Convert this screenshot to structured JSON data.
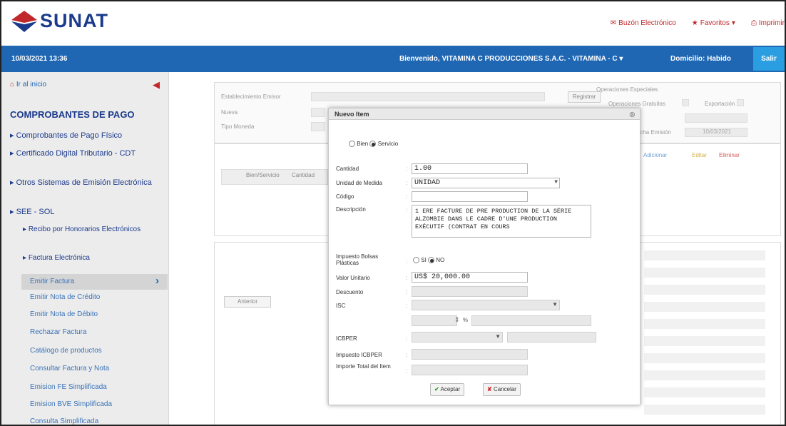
{
  "header": {
    "logo_text": "SUNAT",
    "links": [
      {
        "label": "Buzón Electrónico",
        "icon": "mailbox-icon"
      },
      {
        "label": "Favoritos",
        "icon": "star-icon"
      },
      {
        "label": "Imprimir",
        "icon": "printer-icon"
      }
    ],
    "colors": {
      "brand_red": "#c0282c",
      "brand_blue": "#1b3a8c",
      "bar_blue": "#1f66b3",
      "exit_blue": "#2a9ee0"
    }
  },
  "bar": {
    "datetime": "10/03/2021 13:36",
    "welcome": "Bienvenido, VITAMINA C PRODUCCIONES S.A.C. - VITAMINA - C",
    "domicile": "Domicilio: Habido",
    "exit_label": "Salir"
  },
  "sidebar": {
    "home": "Ir al inicio",
    "title": "COMPROBANTES DE PAGO",
    "items": [
      "Comprobantes de Pago Físico",
      "Certificado Digital Tributario - CDT",
      "Otros Sistemas de Emisión Electrónica",
      "SEE - SOL"
    ],
    "sub_items": [
      "Recibo por Honorarios Electrónicos",
      "Factura Electrónica"
    ],
    "links": [
      "Emitir Factura",
      "Emitir Nota de Crédito",
      "Emitir Nota de Débito",
      "Rechazar Factura",
      "Catálogo de productos",
      "Consultar Factura y Nota",
      "Emision FE Simplificada",
      "Emision BVE Simplificada",
      "Consulta Simplificada"
    ]
  },
  "background_form": {
    "labels": [
      "Establecimiento Emisor",
      "Nueva",
      "Tipo Moneda",
      "Operaciones Especiales",
      "Operaciones Gratuitas",
      "Exportación",
      "Fecha Emisión"
    ],
    "search_btn": "Registrar",
    "table_headers": [
      "Bien/Servicio",
      "Cantidad"
    ],
    "actions": [
      "Adicionar",
      "Editar",
      "Eliminar"
    ],
    "prev_btn": "Anterior",
    "date_value": "10/03/2021"
  },
  "modal": {
    "title": "Nuevo Item",
    "type_options": [
      "Bien",
      "Servicio"
    ],
    "type_selected": "Servicio",
    "fields": {
      "cantidad_label": "Cantidad",
      "cantidad_value": "1.00",
      "unidad_label": "Unidad de Medida",
      "unidad_value": "UNIDAD",
      "codigo_label": "Código",
      "codigo_value": "",
      "descripcion_label": "Descripción",
      "descripcion_value": "1 ERE FACTURE DE PRE PRODUCTION DE LA SÉRIE ALZOMBIE DANS LE CADRE D'UNE PRODUCTION EXÉCUTIF (CONTRAT EN COURS",
      "bolsas_label": "Impuesto Bolsas Plásticas",
      "bolsas_options": [
        "SI",
        "NO"
      ],
      "bolsas_selected": "NO",
      "valor_label": "Valor Unitario",
      "valor_value": "US$ 20,000.00",
      "descuento_label": "Descuento",
      "isc_label": "ISC",
      "icbper_label": "ICBPER",
      "impuesto_icbper_label": "Impuesto ICBPER",
      "importe_label": "Importe Total del Item",
      "percent_symbol": "%"
    },
    "accept_label": "Aceptar",
    "cancel_label": "Cancelar"
  }
}
